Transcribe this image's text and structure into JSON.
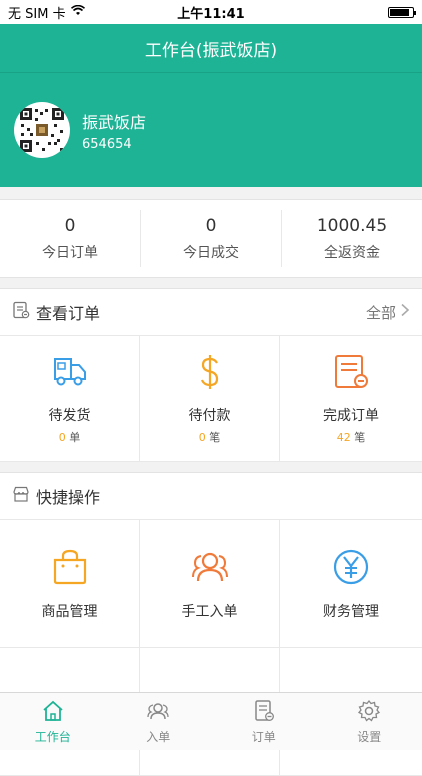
{
  "status_bar": {
    "carrier": "无 SIM 卡",
    "time": "上午11:41"
  },
  "header": {
    "title": "工作台(振武饭店)"
  },
  "profile": {
    "name": "振武饭店",
    "id": "654654"
  },
  "stats": [
    {
      "value": "0",
      "label": "今日订单"
    },
    {
      "value": "0",
      "label": "今日成交"
    },
    {
      "value": "1000.45",
      "label": "全返资金"
    }
  ],
  "orders_section": {
    "title": "查看订单",
    "more_label": "全部",
    "items": [
      {
        "label": "待发货",
        "count": "0",
        "unit": "单"
      },
      {
        "label": "待付款",
        "count": "0",
        "unit": "笔"
      },
      {
        "label": "完成订单",
        "count": "42",
        "unit": "笔"
      }
    ]
  },
  "quick_section": {
    "title": "快捷操作",
    "items": [
      {
        "label": "商品管理"
      },
      {
        "label": "手工入单"
      },
      {
        "label": "财务管理"
      }
    ]
  },
  "tabbar": {
    "items": [
      {
        "label": "工作台"
      },
      {
        "label": "入单"
      },
      {
        "label": "订单"
      },
      {
        "label": "设置"
      }
    ]
  },
  "colors": {
    "brand": "#1fb395",
    "accent_orange": "#f5a623",
    "blue_icon": "#3a9ee6",
    "orange_icon": "#f07a3a"
  }
}
